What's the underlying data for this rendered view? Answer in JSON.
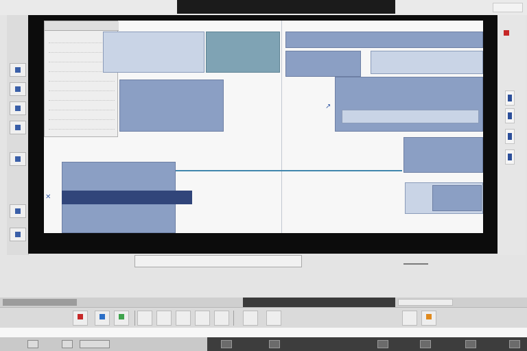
{
  "window": {
    "title": "",
    "banner_text": "",
    "status_left": "",
    "status_center": "",
    "zoom": ""
  },
  "canvas": {
    "caption": ""
  },
  "taskbar": {
    "text": ""
  },
  "bottom": {
    "left_text": "",
    "mid_text": "",
    "right_text_1": "",
    "right_text_2": ""
  },
  "colors": {
    "accent": "#3a5fa8",
    "block": "#8b9fc4",
    "block_dark": "#31457a",
    "connector": "#3f86ad",
    "monitor_frame": "#0c0c0c"
  },
  "icons": [
    "arrow-icon",
    "close-icon",
    "settings-icon",
    "chart-icon",
    "font-icon"
  ]
}
